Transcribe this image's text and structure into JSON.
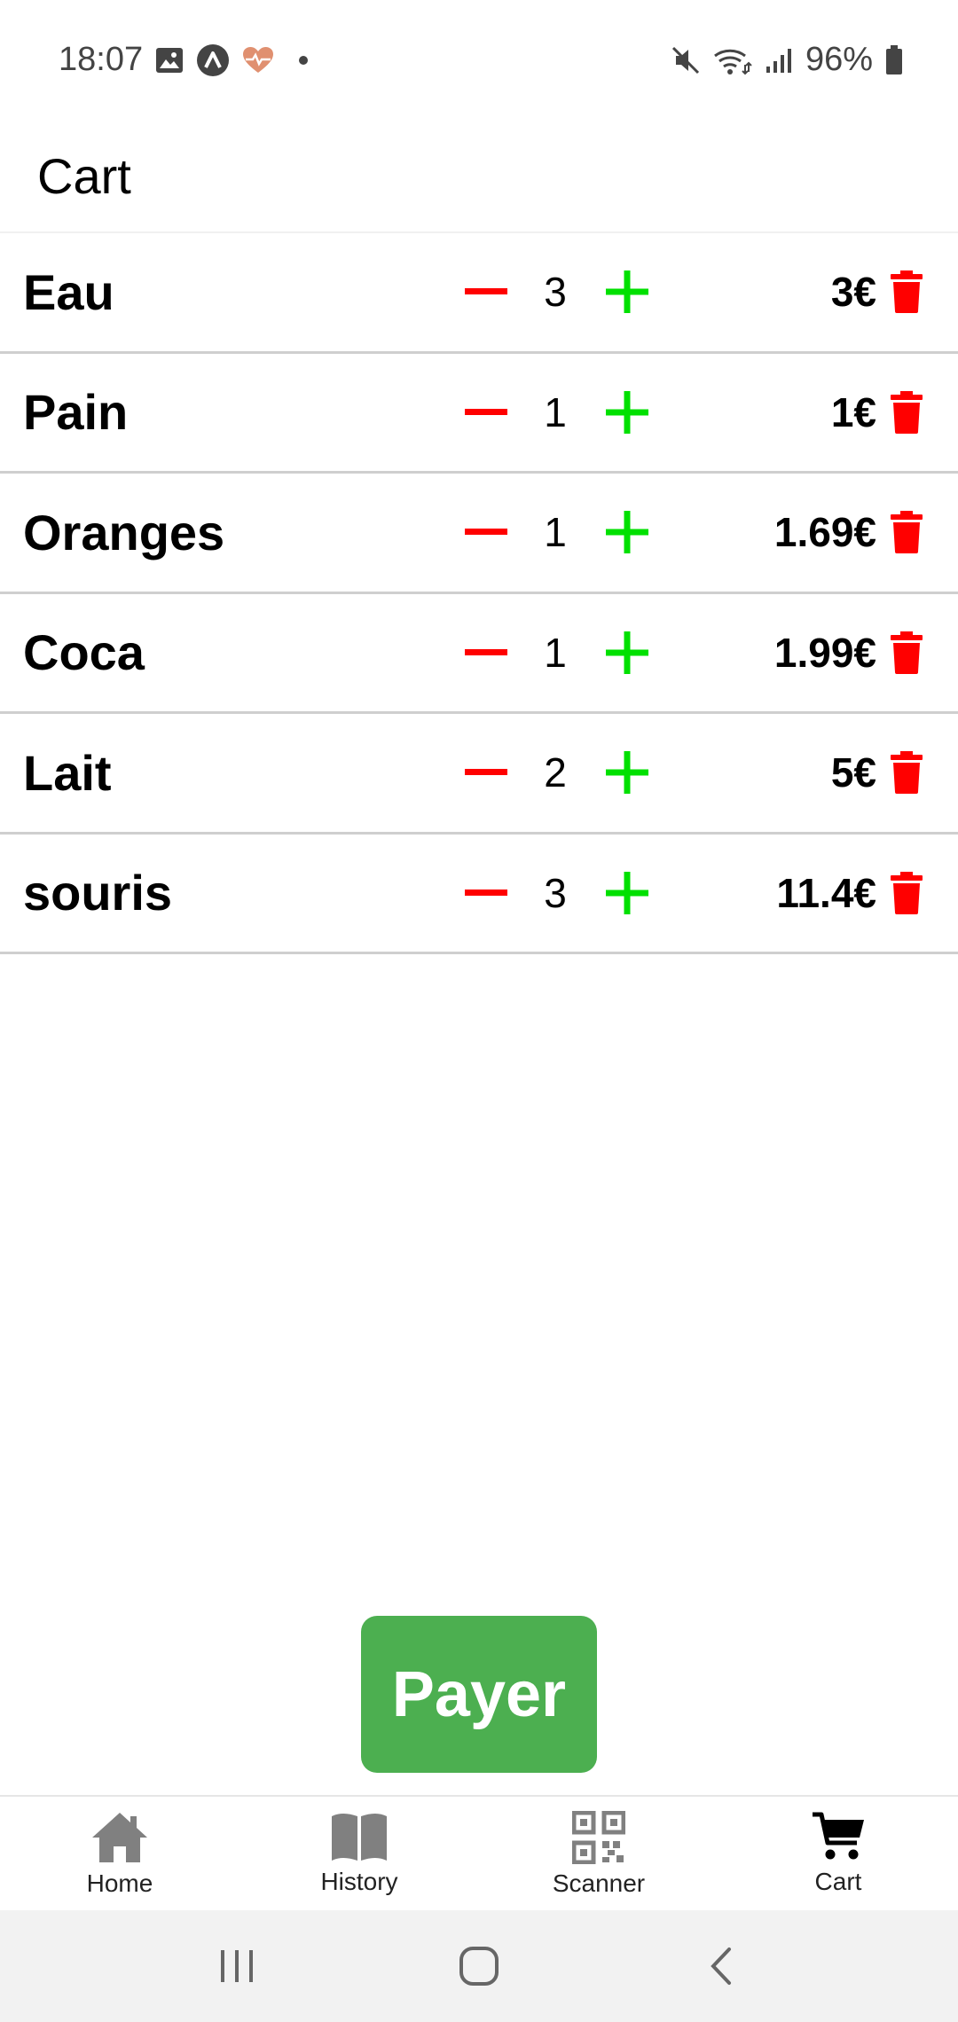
{
  "status_bar": {
    "time": "18:07",
    "battery_percent": "96%",
    "icons_left": [
      "image-icon",
      "app-a-icon",
      "heart-pulse-icon",
      "dot-icon"
    ],
    "icons_right": [
      "mute-icon",
      "wifi-icon",
      "signal-icon",
      "battery-icon"
    ]
  },
  "header": {
    "title": "Cart"
  },
  "cart": {
    "items": [
      {
        "name": "Eau",
        "quantity": "3",
        "price": "3€"
      },
      {
        "name": "Pain",
        "quantity": "1",
        "price": "1€"
      },
      {
        "name": "Oranges",
        "quantity": "1",
        "price": "1.69€"
      },
      {
        "name": "Coca",
        "quantity": "1",
        "price": "1.99€"
      },
      {
        "name": "Lait",
        "quantity": "2",
        "price": "5€"
      },
      {
        "name": "souris",
        "quantity": "3",
        "price": "11.4€"
      }
    ]
  },
  "pay_button": {
    "label": "Payer"
  },
  "tabs": [
    {
      "label": "Home",
      "icon": "home-icon",
      "active": false
    },
    {
      "label": "History",
      "icon": "book-icon",
      "active": false
    },
    {
      "label": "Scanner",
      "icon": "qr-code-icon",
      "active": false
    },
    {
      "label": "Cart",
      "icon": "cart-icon",
      "active": true
    }
  ],
  "colors": {
    "minus": "#ff0000",
    "plus": "#00e000",
    "trash": "#ff0000",
    "pay": "#4caf50",
    "tab_inactive_icon": "#808080",
    "tab_active_icon": "#000000"
  }
}
